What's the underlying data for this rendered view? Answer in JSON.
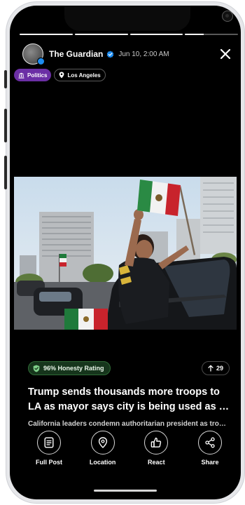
{
  "story": {
    "publisher": "The Guardian",
    "timestamp": "Jun 10, 2:00 AM",
    "progress": [
      1,
      1,
      1,
      0.35
    ],
    "tags": {
      "category": "Politics",
      "location": "Los Angeles"
    },
    "honesty_rating": "96% Honesty Rating",
    "upvotes": "29",
    "headline": "Trump sends thousands more troops to LA as mayor says city is being used as a test case for federal overreach",
    "subheadline": "California leaders condemn authoritarian president as troops deploy"
  },
  "actions": [
    {
      "label": "Full Post",
      "icon": "document-icon"
    },
    {
      "label": "Location",
      "icon": "map-pin-icon"
    },
    {
      "label": "React",
      "icon": "thumbs-up-icon"
    },
    {
      "label": "Share",
      "icon": "share-icon"
    }
  ],
  "colors": {
    "background": "#000000",
    "politics_tag": "#6b2fa5",
    "honesty_badge": "#16351c",
    "verified": "#1d8cf0"
  }
}
